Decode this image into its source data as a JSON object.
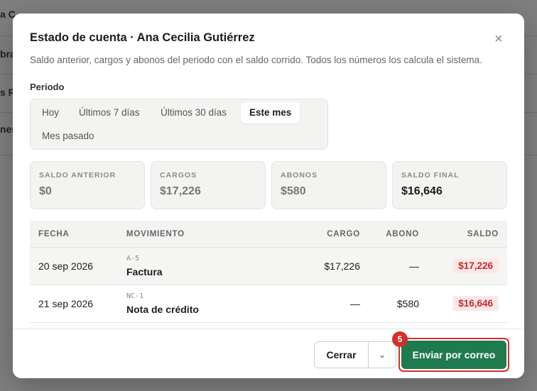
{
  "background": {
    "rows": [
      "a C",
      "bra",
      "s R",
      "ner"
    ]
  },
  "modal": {
    "title": "Estado de cuenta · Ana Cecilia Gutiérrez",
    "description": "Saldo anterior, cargos y abonos del periodo con el saldo corrido. Todos los números los calcula el sistema.",
    "close_icon": "close-icon"
  },
  "period": {
    "label": "Periodo",
    "options": [
      "Hoy",
      "Últimos 7 días",
      "Últimos 30 días",
      "Este mes",
      "Mes pasado"
    ],
    "selected": "Este mes"
  },
  "summary": [
    {
      "label": "SALDO ANTERIOR",
      "value": "$0"
    },
    {
      "label": "CARGOS",
      "value": "$17,226"
    },
    {
      "label": "ABONOS",
      "value": "$580"
    },
    {
      "label": "SALDO FINAL",
      "value": "$16,646"
    }
  ],
  "table": {
    "columns": [
      "FECHA",
      "MOVIMIENTO",
      "CARGO",
      "ABONO",
      "SALDO"
    ],
    "rows": [
      {
        "fecha": "20 sep 2026",
        "ref": "A-5",
        "movimiento": "Factura",
        "cargo": "$17,226",
        "abono": "—",
        "saldo": "$17,226"
      },
      {
        "fecha": "21 sep 2026",
        "ref": "NC-1",
        "movimiento": "Nota de crédito",
        "cargo": "—",
        "abono": "$580",
        "saldo": "$16,646"
      }
    ]
  },
  "footer": {
    "close_label": "Cerrar",
    "send_label": "Enviar por correo",
    "badge": "5"
  },
  "colors": {
    "primary": "#1f7a4f",
    "negative": "#c62828",
    "highlight": "#d32f2f"
  }
}
